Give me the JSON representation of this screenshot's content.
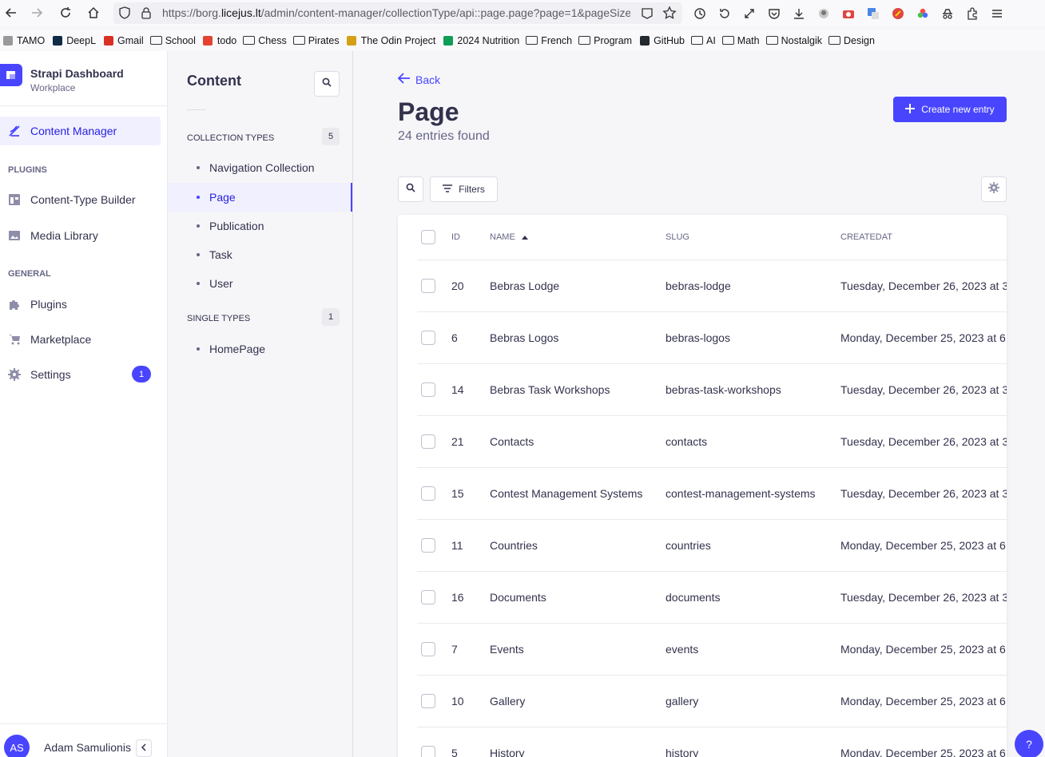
{
  "browser": {
    "url_prefix": "https://borg.",
    "url_domain": "licejus.lt",
    "url_path": "/admin/content-manager/collectionType/api::page.page?page=1&pageSize="
  },
  "bookmarks": [
    {
      "label": "TAMO",
      "icon": "tamo-icon"
    },
    {
      "label": "DeepL",
      "icon": "deepl-icon"
    },
    {
      "label": "Gmail",
      "icon": "gmail-icon"
    },
    {
      "label": "School",
      "icon": "folder-icon"
    },
    {
      "label": "todo",
      "icon": "todoist-icon"
    },
    {
      "label": "Chess",
      "icon": "folder-icon"
    },
    {
      "label": "Pirates",
      "icon": "folder-icon"
    },
    {
      "label": "The Odin Project",
      "icon": "odin-icon"
    },
    {
      "label": "2024 Nutrition",
      "icon": "sheet-icon"
    },
    {
      "label": "French",
      "icon": "folder-icon"
    },
    {
      "label": "Program",
      "icon": "folder-icon"
    },
    {
      "label": "GitHub",
      "icon": "github-icon"
    },
    {
      "label": "AI",
      "icon": "folder-icon"
    },
    {
      "label": "Math",
      "icon": "folder-icon"
    },
    {
      "label": "Nostalgik",
      "icon": "folder-icon"
    },
    {
      "label": "Design",
      "icon": "folder-icon"
    }
  ],
  "brand": {
    "title": "Strapi Dashboard",
    "subtitle": "Workplace"
  },
  "mainnav": {
    "content_manager": "Content Manager",
    "plugins_heading": "PLUGINS",
    "ctb": "Content-Type Builder",
    "media": "Media Library",
    "general_heading": "GENERAL",
    "plugins": "Plugins",
    "marketplace": "Marketplace",
    "settings": "Settings",
    "settings_badge": "1"
  },
  "user": {
    "initials": "AS",
    "name": "Adam Samulionis"
  },
  "subnav": {
    "title": "Content",
    "collection_heading": "COLLECTION TYPES",
    "collection_count": "5",
    "collections": [
      "Navigation Collection",
      "Page",
      "Publication",
      "Task",
      "User"
    ],
    "single_heading": "SINGLE TYPES",
    "single_count": "1",
    "singles": [
      "HomePage"
    ]
  },
  "main": {
    "back": "Back",
    "title": "Page",
    "subtitle": "24 entries found",
    "create": "Create new entry",
    "filters": "Filters"
  },
  "table": {
    "headers": {
      "id": "ID",
      "name": "NAME",
      "slug": "SLUG",
      "created": "CREATEDAT"
    },
    "rows": [
      {
        "id": "20",
        "name": "Bebras Lodge",
        "slug": "bebras-lodge",
        "created": "Tuesday, December 26, 2023 at 3"
      },
      {
        "id": "6",
        "name": "Bebras Logos",
        "slug": "bebras-logos",
        "created": "Monday, December 25, 2023 at 6"
      },
      {
        "id": "14",
        "name": "Bebras Task Workshops",
        "slug": "bebras-task-workshops",
        "created": "Tuesday, December 26, 2023 at 3"
      },
      {
        "id": "21",
        "name": "Contacts",
        "slug": "contacts",
        "created": "Tuesday, December 26, 2023 at 3"
      },
      {
        "id": "15",
        "name": "Contest Management Systems",
        "slug": "contest-management-systems",
        "created": "Tuesday, December 26, 2023 at 3"
      },
      {
        "id": "11",
        "name": "Countries",
        "slug": "countries",
        "created": "Monday, December 25, 2023 at 6"
      },
      {
        "id": "16",
        "name": "Documents",
        "slug": "documents",
        "created": "Tuesday, December 26, 2023 at 3"
      },
      {
        "id": "7",
        "name": "Events",
        "slug": "events",
        "created": "Monday, December 25, 2023 at 6"
      },
      {
        "id": "10",
        "name": "Gallery",
        "slug": "gallery",
        "created": "Monday, December 25, 2023 at 6"
      },
      {
        "id": "5",
        "name": "History",
        "slug": "history",
        "created": "Monday, December 25, 2023 at 6"
      }
    ]
  },
  "help": "?",
  "colors": {
    "accent": "#4945ff",
    "accent_light": "#f0f0ff",
    "text": "#32324d",
    "muted": "#666687"
  }
}
